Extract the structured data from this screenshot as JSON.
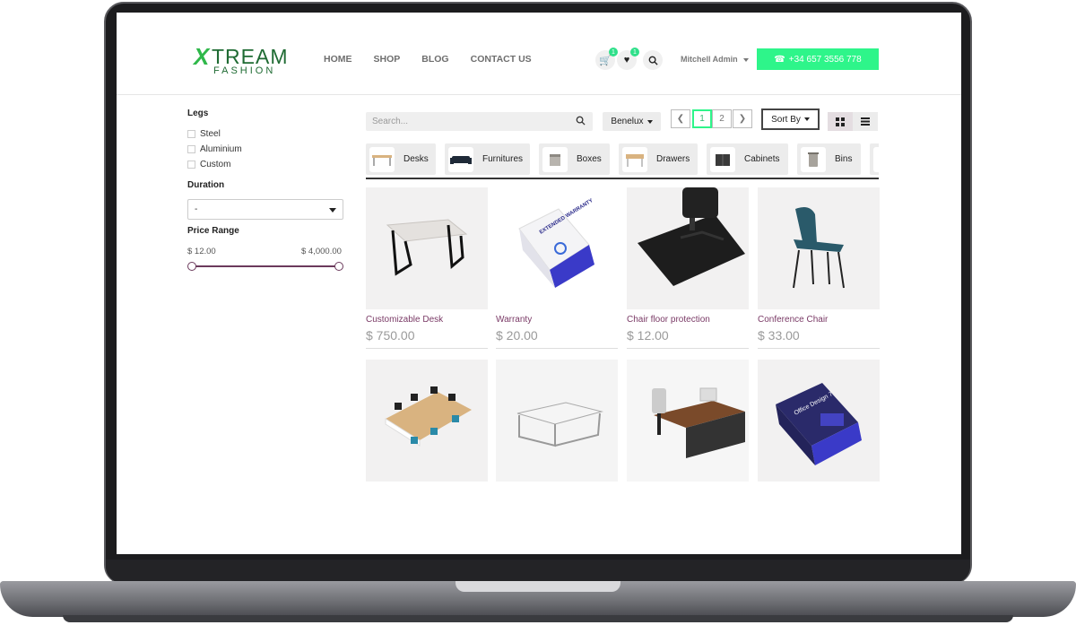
{
  "brand": {
    "logo_x": "X",
    "logo_text": "TREAM",
    "logo_sub": "FASHION"
  },
  "nav": {
    "items": [
      "HOME",
      "SHOP",
      "BLOG",
      "CONTACT US"
    ]
  },
  "header": {
    "cart_count": "1",
    "wishlist_count": "1",
    "user": "Mitchell Admin",
    "phone": "+34 657 3556 778"
  },
  "filters": {
    "legs_title": "Legs",
    "legs_options": [
      "Steel",
      "Aluminium",
      "Custom"
    ],
    "duration_title": "Duration",
    "duration_value": "-",
    "price_title": "Price Range",
    "price_min": "$ 12.00",
    "price_max": "$ 4,000.00"
  },
  "toolbar": {
    "search_placeholder": "Search...",
    "pricelist": "Benelux",
    "pages": [
      "1",
      "2"
    ],
    "active_page": "1",
    "sort_label": "Sort By"
  },
  "categories": [
    "Desks",
    "Furnitures",
    "Boxes",
    "Drawers",
    "Cabinets",
    "Bins"
  ],
  "products": [
    {
      "name": "Customizable Desk",
      "price": "$ 750.00"
    },
    {
      "name": "Warranty",
      "price": "$ 20.00"
    },
    {
      "name": "Chair floor protection",
      "price": "$ 12.00"
    },
    {
      "name": "Conference Chair",
      "price": "$ 33.00"
    },
    {
      "name": "",
      "price": ""
    },
    {
      "name": "",
      "price": ""
    },
    {
      "name": "",
      "price": ""
    },
    {
      "name": "",
      "price": ""
    }
  ],
  "product_box_labels": {
    "warranty": "EXTENDED WARRANTY",
    "office_design": "Office Design 7"
  },
  "colors": {
    "accent": "#2ef58a",
    "product_name": "#7a3a66",
    "logo_green": "#1f6b33"
  }
}
